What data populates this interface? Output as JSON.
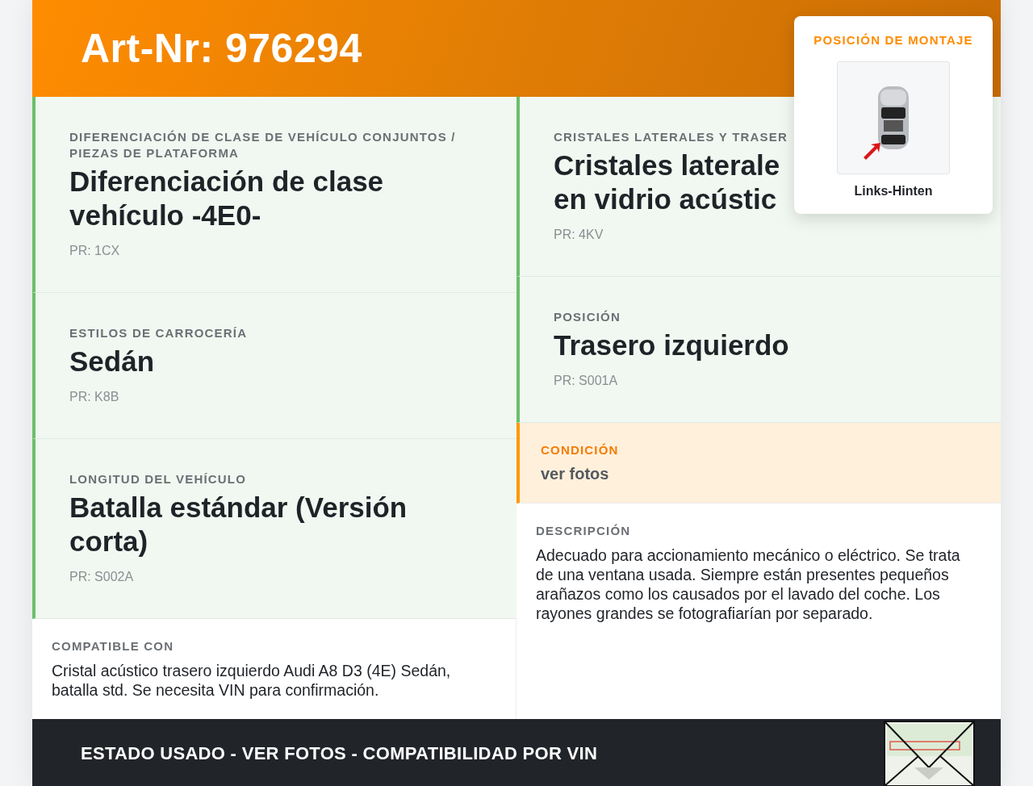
{
  "header": {
    "title": "Art-Nr: 976294"
  },
  "mounting_position": {
    "label": "POSICIÓN DE MONTAJE",
    "caption": "Links-Hinten"
  },
  "left_cards": [
    {
      "label": "DIFERENCIACIÓN DE CLASE DE VEHÍCULO CONJUNTOS / PIEZAS DE PLATAFORMA",
      "value": "Diferenciación de clase vehículo -4E0-",
      "pr": "PR: 1CX"
    },
    {
      "label": "ESTILOS DE CARROCERÍA",
      "value": "Sedán",
      "pr": "PR: K8B"
    },
    {
      "label": "LONGITUD DEL VEHÍCULO",
      "value": "Batalla estándar (Versión corta)",
      "pr": "PR: S002A"
    }
  ],
  "compatible": {
    "label": "COMPATIBLE CON",
    "text": "Cristal acústico trasero izquierdo Audi A8 D3 (4E) Sedán, batalla std. Se necesita VIN para confirmación."
  },
  "right_cards": [
    {
      "label": "CRISTALES LATERALES Y TRASER",
      "value": "Cristales laterale\nen vidrio acústic",
      "pr": "PR: 4KV"
    },
    {
      "label": "POSICIÓN",
      "value": "Trasero izquierdo",
      "pr": "PR: S001A"
    }
  ],
  "condition": {
    "label": "CONDICIÓN",
    "value": "ver fotos"
  },
  "description": {
    "label": "DESCRIPCIÓN",
    "text": "Adecuado para accionamiento mecánico o eléctrico. Se trata de una ventana usada. Siempre están presentes pequeños arañazos como los causados por el lavado del coche. Los rayones grandes se fotografiarían por separado."
  },
  "footer": {
    "text": "ESTADO USADO - VER FOTOS - COMPATIBILIDAD POR VIN"
  }
}
